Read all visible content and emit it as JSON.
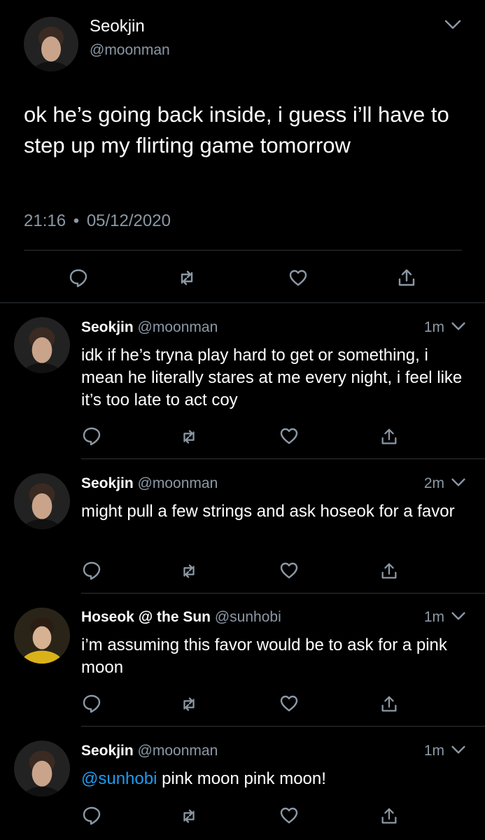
{
  "main_tweet": {
    "name": "Seokjin",
    "handle": "@moonman",
    "text": "ok he’s going back inside, i guess i’ll have to step up my flirting game tomorrow",
    "time": "21:16",
    "separator": "•",
    "date": "05/12/2020",
    "actions": [
      "reply-icon",
      "retweet-icon",
      "like-icon",
      "share-icon"
    ]
  },
  "replies": [
    {
      "name": "Seokjin",
      "handle": "@moonman",
      "time": "1m",
      "text": "idk if he’s tryna play hard to get or something, i mean he literally stares at me every night, i feel like it’s too late to act coy"
    },
    {
      "name": "Seokjin",
      "handle": "@moonman",
      "time": "2m",
      "text": "might pull a few strings and ask hoseok for a favor"
    },
    {
      "name": "Hoseok @ the Sun",
      "handle": "@sunhobi",
      "time": "1m",
      "text": "i’m assuming this favor would be to ask for a pink moon"
    },
    {
      "name": "Seokjin",
      "handle": "@moonman",
      "time": "1m",
      "mention": "@sunhobi",
      "text": " pink moon pink moon!"
    }
  ],
  "colors": {
    "background": "#000000",
    "text": "#ffffff",
    "muted": "#8b98a5",
    "mention": "#1d9bf0",
    "divider": "#2f3336"
  }
}
